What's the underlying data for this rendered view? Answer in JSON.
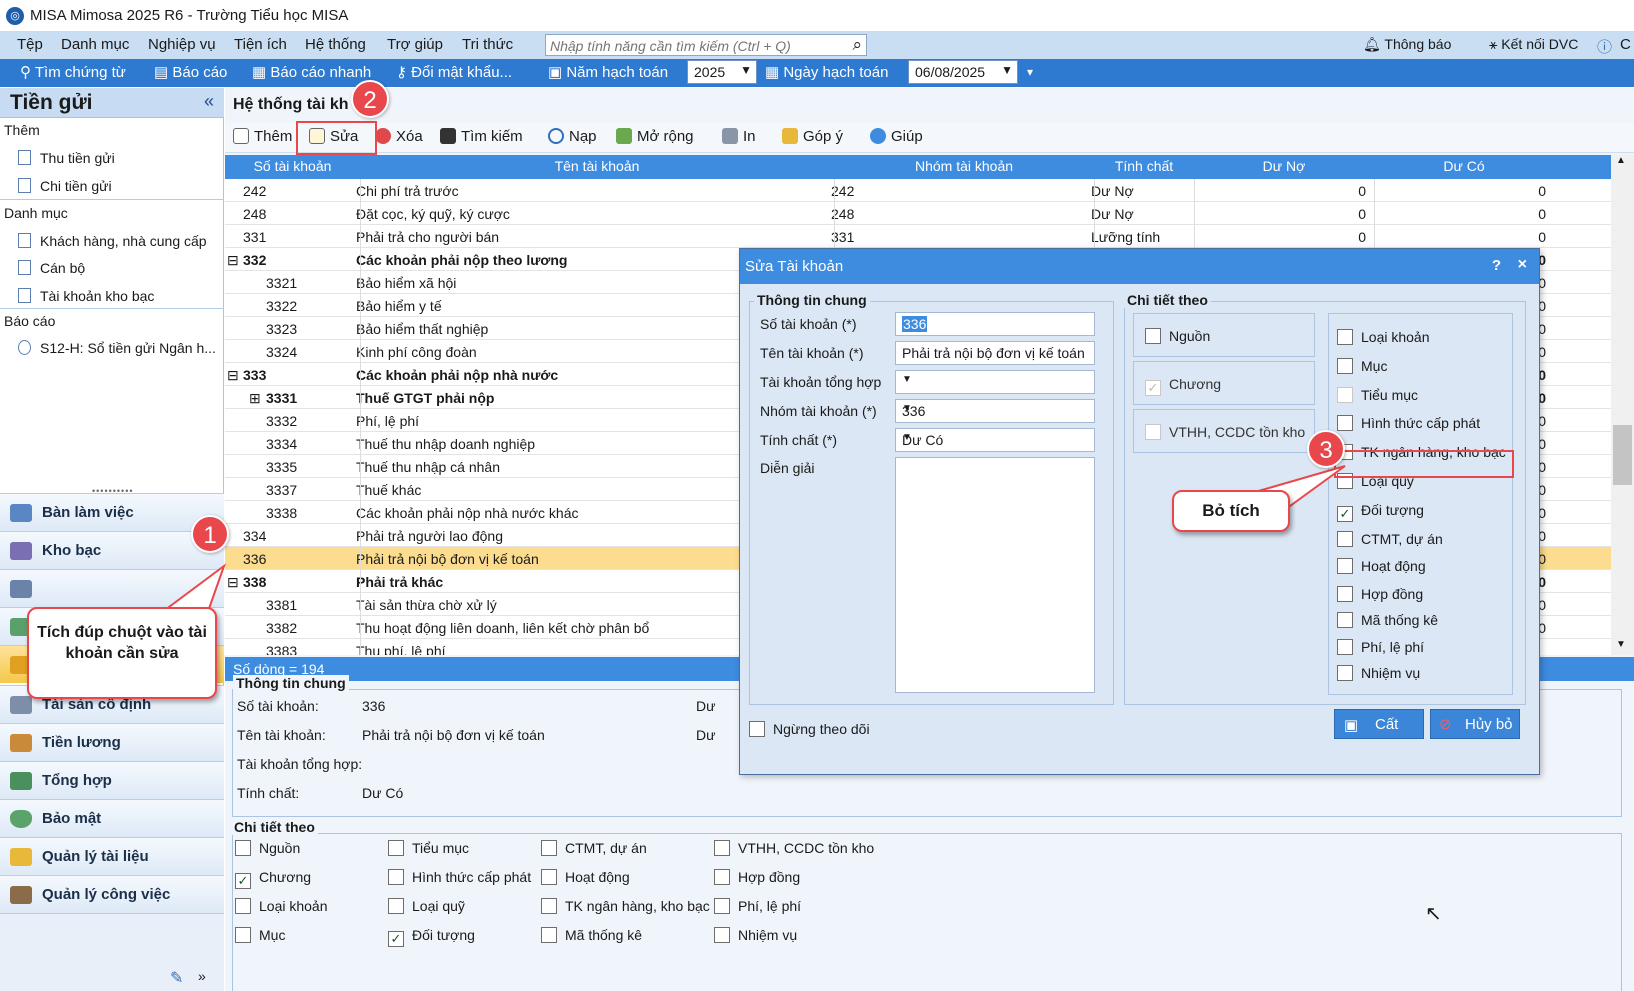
{
  "window": {
    "title": "MISA Mimosa 2025 R6 - Trường Tiểu học MISA"
  },
  "menu": {
    "items": [
      "Tệp",
      "Danh mục",
      "Nghiệp vụ",
      "Tiện ích",
      "Hệ thống",
      "Trợ giúp",
      "Tri thức"
    ],
    "search_placeholder": "Nhập tính năng cần tìm kiếm (Ctrl + Q)",
    "notify": "Thông báo",
    "dvc": "Kết nối DVC",
    "help_short": "C"
  },
  "toolbar": {
    "find": "Tìm chứng từ",
    "report": "Báo cáo",
    "quick_report": "Báo cáo nhanh",
    "change_pwd": "Đổi mật khẩu...",
    "fiscal_year_label": "Năm hạch toán",
    "fiscal_year": "2025",
    "date_label": "Ngày hạch toán",
    "date": "06/08/2025"
  },
  "sidebar": {
    "title": "Tiền gửi",
    "collapse": "«",
    "group_add": "Thêm",
    "add_items": [
      "Thu tiền gửi",
      "Chi tiền gửi"
    ],
    "group_catalog": "Danh mục",
    "catalog_items": [
      "Khách hàng, nhà cung cấp",
      "Cán bộ",
      "Tài khoản kho bạc"
    ],
    "group_report": "Báo cáo",
    "report_items": [
      "S12-H: Sổ tiền gửi Ngân h..."
    ],
    "nav": [
      "Bàn làm việc",
      "Kho bạc",
      "Tài sản cố định",
      "Tiền lương",
      "Tổng hợp",
      "Bảo mật",
      "Quản lý tài liệu",
      "Quản lý công việc"
    ]
  },
  "page": {
    "title": "Hệ thống tài khoản",
    "title_visible": "Hệ thống tài kh"
  },
  "content_toolbar": {
    "add": "Thêm",
    "edit": "Sửa",
    "delete": "Xóa",
    "search": "Tìm kiếm",
    "reload": "Nạp",
    "expand": "Mở rộng",
    "print": "In",
    "feedback": "Góp ý",
    "help": "Giúp"
  },
  "grid": {
    "columns": [
      "Số tài khoản",
      "Tên tài khoản",
      "Nhóm tài khoản",
      "Tính chất",
      "Dư Nợ",
      "Dư Có"
    ],
    "rows": [
      {
        "code": "242",
        "name": "Chi phí trả trước",
        "group": "242",
        "nature": "Dư Nợ",
        "debit": "0",
        "credit": "0"
      },
      {
        "code": "248",
        "name": "Đặt cọc, ký quỹ, ký cược",
        "group": "248",
        "nature": "Dư Nợ",
        "debit": "0",
        "credit": "0"
      },
      {
        "code": "331",
        "name": "Phải trả cho người bán",
        "group": "331",
        "nature": "Lưỡng tính",
        "debit": "0",
        "credit": "0"
      },
      {
        "code": "332",
        "name": "Các khoản phải nộp theo lương",
        "group": "",
        "nature": "",
        "debit": "",
        "credit": "0",
        "bold": true,
        "toggle": "⊟"
      },
      {
        "code": "3321",
        "name": "Bảo hiểm xã hội",
        "group": "",
        "nature": "",
        "debit": "",
        "credit": "0"
      },
      {
        "code": "3322",
        "name": "Bảo hiểm y tế",
        "group": "",
        "nature": "",
        "debit": "",
        "credit": "0"
      },
      {
        "code": "3323",
        "name": "Bảo hiểm thất nghiệp",
        "group": "",
        "nature": "",
        "debit": "",
        "credit": "0"
      },
      {
        "code": "3324",
        "name": "Kinh phí công đoàn",
        "group": "",
        "nature": "",
        "debit": "",
        "credit": "0"
      },
      {
        "code": "333",
        "name": "Các khoản phải nộp nhà nước",
        "group": "",
        "nature": "",
        "debit": "",
        "credit": "0",
        "bold": true,
        "toggle": "⊟"
      },
      {
        "code": "3331",
        "name": "Thuế GTGT phải nộp",
        "group": "",
        "nature": "",
        "debit": "",
        "credit": "0",
        "bold": true,
        "toggle": "⊞"
      },
      {
        "code": "3332",
        "name": "Phí, lệ phí",
        "group": "",
        "nature": "",
        "debit": "",
        "credit": "0"
      },
      {
        "code": "3334",
        "name": "Thuế thu nhập doanh nghiệp",
        "group": "",
        "nature": "",
        "debit": "",
        "credit": "0"
      },
      {
        "code": "3335",
        "name": "Thuế thu nhập cá nhân",
        "group": "",
        "nature": "",
        "debit": "",
        "credit": "0"
      },
      {
        "code": "3337",
        "name": "Thuế khác",
        "group": "",
        "nature": "",
        "debit": "",
        "credit": "0"
      },
      {
        "code": "3338",
        "name": "Các khoản phải nộp nhà nước khác",
        "group": "",
        "nature": "",
        "debit": "",
        "credit": "0"
      },
      {
        "code": "334",
        "name": "Phải trả người lao động",
        "group": "",
        "nature": "",
        "debit": "",
        "credit": "0"
      },
      {
        "code": "336",
        "name": "Phải trả nội bộ đơn vị kế toán",
        "group": "",
        "nature": "",
        "debit": "",
        "credit": "0",
        "selected": true
      },
      {
        "code": "338",
        "name": "Phải trả khác",
        "group": "",
        "nature": "",
        "debit": "",
        "credit": "000.000",
        "bold": true,
        "toggle": "⊟"
      },
      {
        "code": "3381",
        "name": "Tài sản thừa chờ xử lý",
        "group": "",
        "nature": "",
        "debit": "",
        "credit": "0"
      },
      {
        "code": "3382",
        "name": "Thu hoạt động liên doanh, liên kết chờ phân bổ",
        "group": "",
        "nature": "",
        "debit": "",
        "credit": "0"
      },
      {
        "code": "3383",
        "name": "Thu phí, lệ phí",
        "group": "",
        "nature": "",
        "debit": "",
        "credit": ""
      }
    ],
    "row_count": "Số dòng = 194"
  },
  "detail": {
    "legend": "Thông tin chung",
    "labels": {
      "code": "Số tài khoản:",
      "name": "Tên tài khoản:",
      "parent": "Tài khoản tổng hợp:",
      "nature": "Tính chất:",
      "du": "Dư"
    },
    "values": {
      "code": "336",
      "name": "Phải trả nội bộ đơn vị kế toán",
      "nature": "Dư Có"
    },
    "track_legend": "Chi tiết theo",
    "checks": [
      {
        "label": "Nguồn",
        "checked": false
      },
      {
        "label": "Chương",
        "checked": true
      },
      {
        "label": "Loại khoản",
        "checked": false
      },
      {
        "label": "Mục",
        "checked": false
      },
      {
        "label": "Tiểu mục",
        "checked": false
      },
      {
        "label": "Hình thức cấp phát",
        "checked": false
      },
      {
        "label": "Loại quỹ",
        "checked": false
      },
      {
        "label": "Đối tượng",
        "checked": true
      },
      {
        "label": "CTMT, dự án",
        "checked": false
      },
      {
        "label": "Hoạt động",
        "checked": false
      },
      {
        "label": "TK ngân hàng, kho bạc",
        "checked": false
      },
      {
        "label": "Mã thống kê",
        "checked": false
      },
      {
        "label": "VTHH, CCDC tồn kho",
        "checked": false
      },
      {
        "label": "Hợp đồng",
        "checked": false
      },
      {
        "label": "Phí, lệ phí",
        "checked": false
      },
      {
        "label": "Nhiệm vụ",
        "checked": false
      }
    ]
  },
  "dialog": {
    "title": "Sửa Tài khoản",
    "help": "?",
    "close": "×",
    "general_legend": "Thông tin chung",
    "code_label": "Số tài khoản (*)",
    "code_value": "336",
    "name_label": "Tên tài khoản (*)",
    "name_value": "Phải trả nội bộ đơn vị kế toán",
    "parent_label": "Tài khoản tổng hợp",
    "parent_value": "",
    "group_label": "Nhóm tài khoản (*)",
    "group_value": "336",
    "nature_label": "Tính chất (*)",
    "nature_value": "Dư Có",
    "desc_label": "Diễn giải",
    "track_legend": "Chi tiết theo",
    "left_checks": [
      {
        "label": "Nguồn",
        "checked": false,
        "disabled": false
      },
      {
        "label": "Chương",
        "checked": true,
        "disabled": true
      },
      {
        "label": "VTHH, CCDC tồn kho",
        "checked": false,
        "disabled": true
      }
    ],
    "right_checks": [
      {
        "label": "Loại khoản",
        "checked": false
      },
      {
        "label": "Mục",
        "checked": false
      },
      {
        "label": "Tiểu mục",
        "checked": false,
        "disabled": true
      },
      {
        "label": "Hình thức cấp phát",
        "checked": false
      },
      {
        "label": "TK ngân hàng, kho bạc",
        "checked": false
      },
      {
        "label": "Loại quỹ",
        "checked": false
      },
      {
        "label": "Đối tượng",
        "checked": true
      },
      {
        "label": "CTMT, dự án",
        "checked": false
      },
      {
        "label": "Hoạt động",
        "checked": false
      },
      {
        "label": "Hợp đồng",
        "checked": false
      },
      {
        "label": "Mã thống kê",
        "checked": false
      },
      {
        "label": "Phí, lệ phí",
        "checked": false
      },
      {
        "label": "Nhiệm vụ",
        "checked": false
      }
    ],
    "inactive_label": "Ngừng theo dõi",
    "save": "Cất",
    "cancel": "Hủy bỏ"
  },
  "annotations": {
    "step1": "1",
    "step1_text": "Tích đúp chuột vào tài khoản cần sửa",
    "step2": "2",
    "step3": "3",
    "step3_text": "Bỏ tích"
  }
}
